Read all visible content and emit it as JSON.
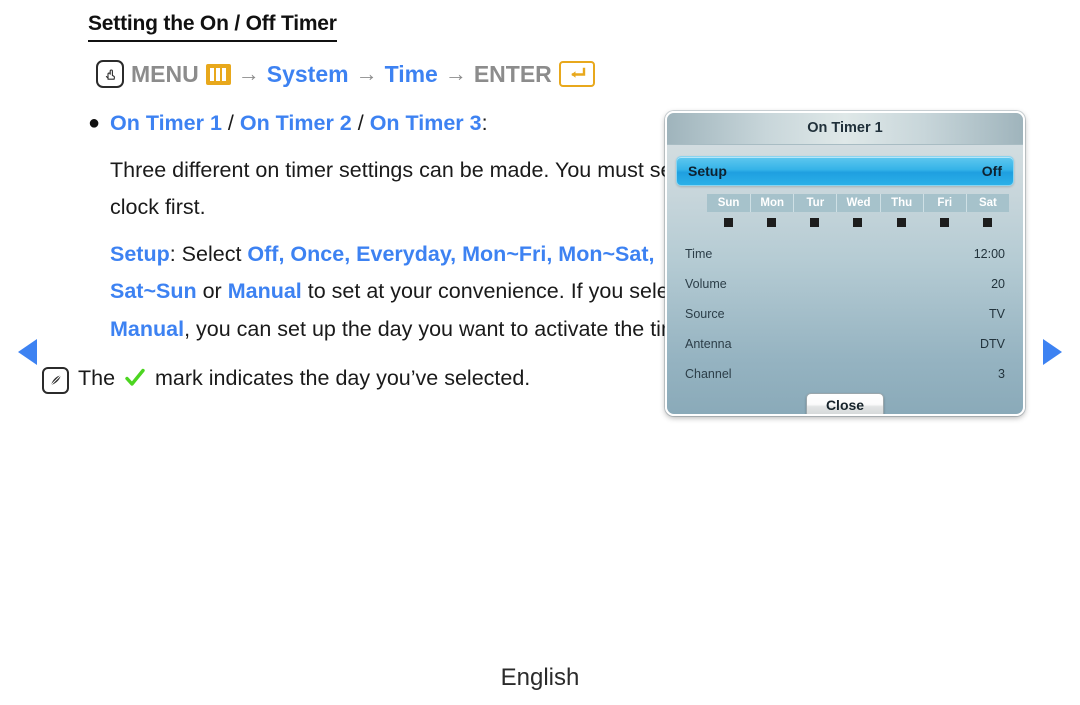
{
  "page": {
    "title": "Setting the On / Off Timer",
    "footer_language": "English"
  },
  "menu_path": {
    "remote_icon": "remote-hand-icon",
    "menu_label": "MENU",
    "menu_icon": "menu-bars-icon",
    "arrow": "→",
    "system_label": "System",
    "time_label": "Time",
    "enter_label": "ENTER",
    "enter_icon": "enter-return-icon",
    "blue_color": "#3d82f2",
    "gray_color": "#8c8c8c",
    "gold_color": "#e8a81c"
  },
  "content": {
    "bullet_marker": "●",
    "timer1": "On Timer 1",
    "sep1": " / ",
    "timer2": "On Timer 2",
    "sep2": " / ",
    "timer3": "On Timer 3",
    "colon": ":",
    "desc_line": "Three different on timer settings can be made. You must set the clock first.",
    "setup_label": "Setup",
    "setup_select": ": Select ",
    "opt_off": "Off,",
    "opt_once": " Once,",
    "opt_everyday": " Everyday,",
    "opt_monfri": "Mon~Fri,",
    "opt_monsat": " Mon~Sat,",
    "opt_satsun": " Sat~Sun",
    "opt_or": " or ",
    "opt_manual": "Manual",
    "convenience_text": "to set at your convenience. If you select ",
    "manual_inline": "Manual",
    "manual_rest": ", you can set up the day you want to activate the timer.",
    "note_icon": "note-pencil-icon",
    "note_prefix": "The ",
    "note_check_icon": "green-check-icon",
    "note_suffix": " mark indicates the day you’ve selected.",
    "check_color": "#4cd521"
  },
  "nav": {
    "prev_icon": "triangle-left-icon",
    "next_icon": "triangle-right-icon",
    "arrow_color": "#3d82f2"
  },
  "osd": {
    "title": "On Timer 1",
    "setup_row": {
      "label": "Setup",
      "value": "Off"
    },
    "days": [
      {
        "label": "Sun",
        "checked": true
      },
      {
        "label": "Mon",
        "checked": true
      },
      {
        "label": "Tur",
        "checked": true
      },
      {
        "label": "Wed",
        "checked": true
      },
      {
        "label": "Thu",
        "checked": true
      },
      {
        "label": "Fri",
        "checked": true
      },
      {
        "label": "Sat",
        "checked": true
      }
    ],
    "rows": [
      {
        "label": "Time",
        "value": "12:00"
      },
      {
        "label": "Volume",
        "value": "20"
      },
      {
        "label": "Source",
        "value": "TV"
      },
      {
        "label": "Antenna",
        "value": "DTV"
      },
      {
        "label": "Channel",
        "value": "3"
      }
    ],
    "close_label": "Close",
    "highlight_color": "#2bb0e8"
  }
}
